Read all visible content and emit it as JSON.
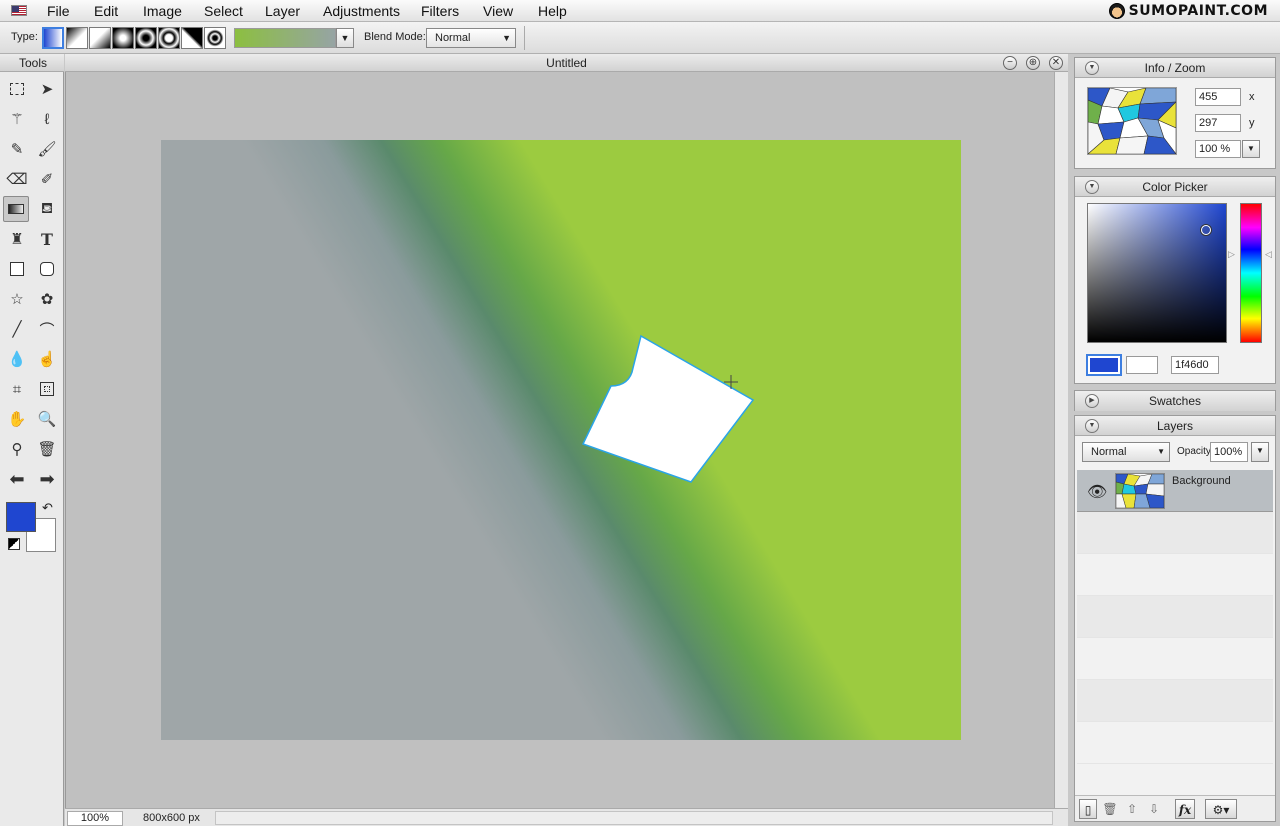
{
  "app": {
    "logo_text": "SUMOPAINT.COM"
  },
  "menu": [
    "File",
    "Edit",
    "Image",
    "Select",
    "Layer",
    "Adjustments",
    "Filters",
    "View",
    "Help"
  ],
  "options": {
    "type_label": "Type:",
    "gradient_types": [
      "linear-gradient-icon",
      "diagonal-gradient-icon",
      "diagonal-reverse-gradient-icon",
      "square-gradient-icon",
      "radial-gradient-icon",
      "ring-gradient-icon",
      "angle-gradient-icon",
      "spiral-gradient-icon"
    ],
    "active_type_index": 0,
    "gradient_colors": [
      "#8cbf40",
      "#96a4a4"
    ],
    "blend_mode_label": "Blend Mode:",
    "blend_mode_value": "Normal"
  },
  "tools": {
    "title": "Tools",
    "items": [
      "rectangle-select-tool",
      "move-tool",
      "magic-wand-tool",
      "lasso-tool",
      "pencil-tool",
      "brush-tool",
      "eraser-tool",
      "smudge-tool",
      "gradient-tool",
      "fill-bucket-tool",
      "clone-stamp-tool",
      "text-tool",
      "rectangle-tool",
      "rounded-rectangle-tool",
      "star-tool",
      "flower-shape-tool",
      "line-tool",
      "curve-tool",
      "blur-tool",
      "dodge-tool",
      "crop-tool",
      "transform-tool",
      "hand-tool",
      "zoom-tool",
      "eyedropper-tool",
      "trash-tool",
      "undo-arrow-tool",
      "redo-arrow-tool"
    ],
    "active_tool": "gradient-tool",
    "foreground_color": "#1f46d0",
    "background_color": "#ffffff"
  },
  "document": {
    "title": "Untitled",
    "zoom": "100%",
    "size": "800x600 px"
  },
  "info_zoom": {
    "title": "Info / Zoom",
    "x_value": "455",
    "x_label": "x",
    "y_value": "297",
    "y_label": "y",
    "zoom_value": "100 %"
  },
  "color_picker": {
    "title": "Color Picker",
    "hex_value": "1f46d0",
    "selected_color": "#1f46d0"
  },
  "swatches": {
    "title": "Swatches"
  },
  "layers": {
    "title": "Layers",
    "mode": "Normal",
    "opacity_label": "Opacity:",
    "opacity_value": "100%",
    "items": [
      {
        "name": "Background",
        "visible": true
      }
    ]
  }
}
